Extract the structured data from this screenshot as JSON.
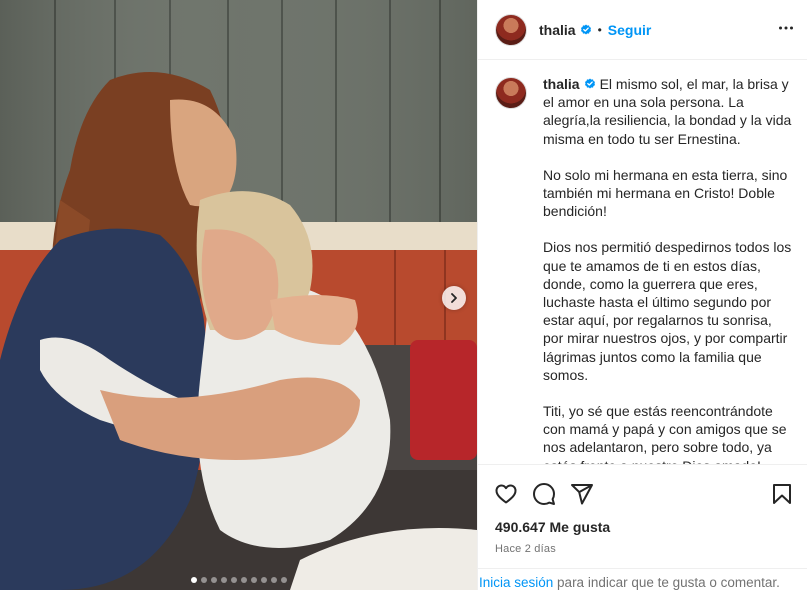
{
  "post": {
    "username": "thalia",
    "follow_label": "Seguir",
    "separator": "•",
    "caption_paragraphs": [
      "El mismo sol, el mar, la brisa y el amor en una sola persona. La alegría,la resiliencia, la bondad y la vida misma en todo tu ser Ernestina.",
      "No solo mi hermana en esta tierra, sino también mi hermana en Cristo! Doble bendición!",
      "Dios nos permitió despedirnos todos los que te amamos de ti en estos días, donde, como la guerrera que eres, luchaste hasta el último segundo por estar aquí, por regalarnos tu sonrisa, por mirar nuestros ojos, y por compartir lágrimas juntos como la familia que somos.",
      "Titi, yo sé que estás reencontrándote con mamá y papá y con amigos que se nos adelantaron, pero sobre todo, ya estás frente a nuestro Dios amado!"
    ],
    "likes": "490.647 Me gusta",
    "time": "Hace 2 días"
  },
  "carousel": {
    "total_slides": 10,
    "active_index": 0
  },
  "login_bar": {
    "link": "Inicia sesión",
    "text": " para indicar que te gusta o comentar."
  },
  "icons": {
    "verified": "verified-badge-icon",
    "more": "more-options-icon",
    "next": "chevron-right-icon",
    "like": "heart-icon",
    "comment": "comment-icon",
    "share": "share-icon",
    "save": "bookmark-icon"
  },
  "colors": {
    "link_blue": "#0095f6",
    "verified_blue": "#0095f6",
    "text": "#262626",
    "muted": "#737373"
  }
}
